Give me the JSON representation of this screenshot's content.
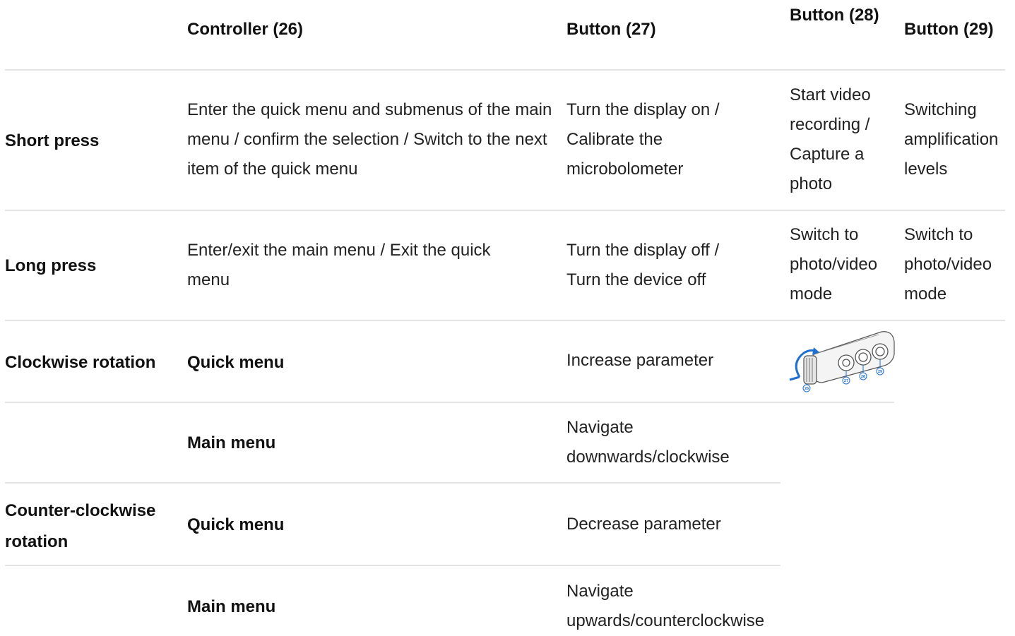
{
  "table": {
    "headers": [
      "",
      "Controller (26)",
      "Button (27)",
      "Button (28)",
      "Button (29)"
    ],
    "short_press": {
      "label": "Short press",
      "controller": "Enter the quick menu and submenus of the main menu / confirm the selection / Switch to the next item of the quick menu",
      "button27": "Turn the display on / Calibrate the microbolometer",
      "button28": "Start video recording / Capture a photo",
      "button29": "Switching amplification levels"
    },
    "long_press": {
      "label": "Long press",
      "controller": "Enter/exit the main menu / Exit the quick menu",
      "button27": "Turn the display off / Turn the device off",
      "button28": "Switch to photo/video mode",
      "button29": "Switch to photo/video mode"
    },
    "clockwise": {
      "label": "Clockwise rotation",
      "quick_menu": "Quick menu",
      "quick_action": "Increase parameter",
      "main_menu": "Main menu",
      "main_action": "Navigate downwards/clockwise"
    },
    "counter_clockwise": {
      "label": "Counter-clockwise rotation",
      "quick_menu": "Quick menu",
      "quick_action": "Decrease parameter",
      "main_menu": "Main menu",
      "main_action": "Navigate upwards/counterclockwise"
    }
  },
  "diagram": {
    "callouts": [
      "26",
      "27",
      "28",
      "29"
    ],
    "accent_color": "#1f6fd1"
  }
}
